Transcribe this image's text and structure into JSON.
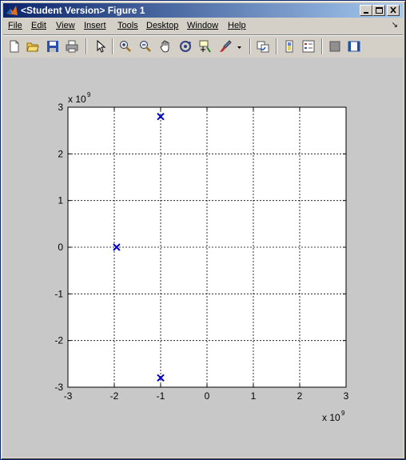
{
  "window": {
    "title": "<Student Version> Figure 1"
  },
  "menu": {
    "items": [
      "File",
      "Edit",
      "View",
      "Insert",
      "Tools",
      "Desktop",
      "Window",
      "Help"
    ],
    "underline_index": [
      0,
      0,
      0,
      0,
      0,
      0,
      0,
      0
    ]
  },
  "toolbar": {
    "tools": [
      "new-figure-icon",
      "open-file-icon",
      "save-icon",
      "print-icon",
      "edit-plot-arrow-icon",
      "zoom-in-icon",
      "zoom-out-icon",
      "pan-hand-icon",
      "rotate-3d-icon",
      "data-cursor-icon",
      "brush-icon",
      "link-plot-icon",
      "colorbar-icon",
      "legend-icon",
      "hide-plot-tools-icon",
      "show-plot-tools-icon"
    ]
  },
  "chart_data": {
    "type": "scatter",
    "title": "",
    "xlabel": "",
    "ylabel": "",
    "x_exponent_label": "x 10",
    "x_exponent": "9",
    "y_exponent_label": "x 10",
    "y_exponent": "9",
    "xlim": [
      -3,
      3
    ],
    "ylim": [
      -3,
      3
    ],
    "xticks": [
      -3,
      -2,
      -1,
      0,
      1,
      2,
      3
    ],
    "yticks": [
      -3,
      -2,
      -1,
      0,
      1,
      2,
      3
    ],
    "grid": true,
    "marker": "x",
    "marker_color": "#0000c8",
    "points": [
      {
        "x": -1.0,
        "y": 2.8
      },
      {
        "x": -1.95,
        "y": 0.0
      },
      {
        "x": -1.0,
        "y": -2.8
      }
    ]
  }
}
